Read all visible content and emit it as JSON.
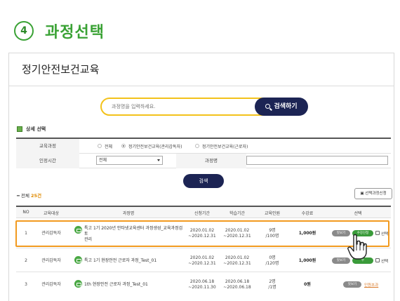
{
  "step": {
    "number": "4",
    "title": "과정선택"
  },
  "panel": {
    "title": "정기안전보건교육"
  },
  "search": {
    "placeholder": "과정명을 입력하세요.",
    "button_label": "검색하기"
  },
  "detail_search": {
    "title": "상세 선택",
    "course_label": "교육과정",
    "course_options": [
      "전체",
      "정기안전보건교육(관리감독자)",
      "정기안전보건교육(근로자)"
    ],
    "course_selected_index": 1,
    "period_label": "인정시간",
    "period_value": "전체",
    "course_name_label": "과정명",
    "course_name_value": "",
    "search_label": "검색"
  },
  "result": {
    "total_prefix": "전체",
    "total_count": "25건",
    "batch_button": "선택과정신청"
  },
  "table": {
    "headers": [
      "NO",
      "교육대상",
      "과정명",
      "신청기간",
      "학습기간",
      "교육인원",
      "수강료",
      "선택"
    ],
    "rows": [
      {
        "no": "1",
        "target": "관리감독자",
        "name_line1": "특고 1기 2020년 안타넷교육센터 과정생성_교육과정검토",
        "name_line2": "관리",
        "apply_start": "2020.01.02",
        "apply_end": "~2020.12.31",
        "study_start": "2020.01.02",
        "study_end": "~2020.12.31",
        "seats_line1": "9명",
        "seats_line2": "/100명",
        "fee": "1,000원",
        "view": "맛보기",
        "apply": "수강신청",
        "select": "선택"
      },
      {
        "no": "2",
        "target": "관리감독자",
        "name_line1": "특고 1기 현장안전 근로자 과정_Test_01",
        "name_line2": "",
        "apply_start": "2020.01.02",
        "apply_end": "~2020.12.31",
        "study_start": "2020.01.02",
        "study_end": "~2020.12.31",
        "seats_line1": "0명",
        "seats_line2": "/120명",
        "fee": "1,000원",
        "view": "맛보기",
        "apply": "수",
        "select": "선택"
      },
      {
        "no": "3",
        "target": "관리감독자",
        "name_line1": "1th 현장안전 근로자 과정_Test_01",
        "name_line2": "",
        "apply_start": "2020.06.18",
        "apply_end": "~2020.11.30",
        "study_start": "2020.06.18",
        "study_end": "~2020.06.18",
        "seats_line1": "2명",
        "seats_line2": "/1명",
        "fee": "0원",
        "view": "맛보기",
        "detail": "인원초과"
      }
    ]
  },
  "colors": {
    "accent_green": "#3aa235",
    "navy": "#1c2454",
    "highlight": "#f29a1f",
    "search_border": "#f3c21b"
  }
}
